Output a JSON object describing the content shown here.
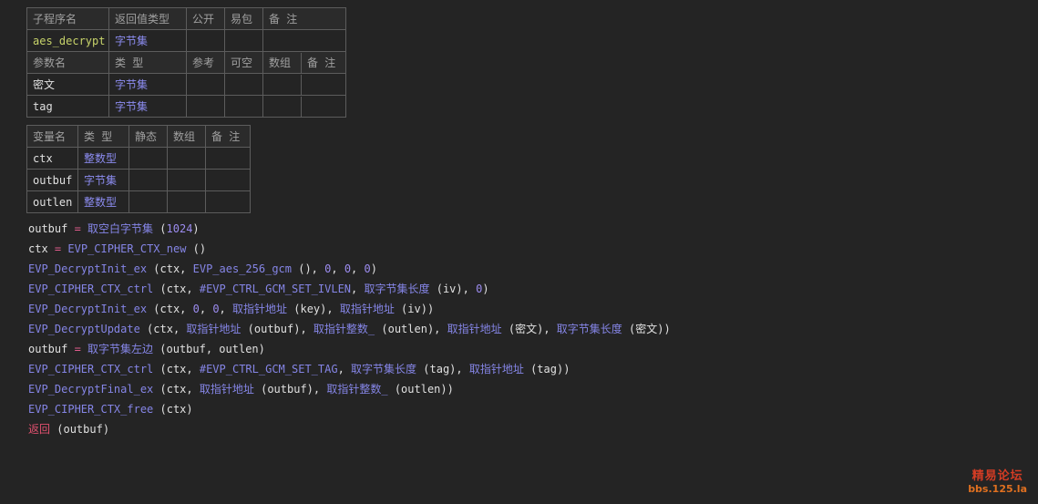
{
  "sub": {
    "headers": [
      "子程序名",
      "返回值类型",
      "公开",
      "易包",
      "备 注"
    ],
    "name": "aes_decrypt",
    "return_type": "字节集"
  },
  "params": {
    "headers": [
      "参数名",
      "类 型",
      "参考",
      "可空",
      "数组",
      "备 注"
    ],
    "rows": [
      {
        "name": "密文",
        "type": "字节集"
      },
      {
        "name": "tag",
        "type": "字节集"
      }
    ]
  },
  "vars": {
    "headers": [
      "变量名",
      "类 型",
      "静态",
      "数组",
      "备 注"
    ],
    "rows": [
      {
        "name": "ctx",
        "type": "整数型"
      },
      {
        "name": "outbuf",
        "type": "字节集"
      },
      {
        "name": "outlen",
        "type": "整数型"
      }
    ]
  },
  "code": [
    [
      [
        "plain",
        "outbuf "
      ],
      [
        "op",
        "="
      ],
      [
        "plain",
        " "
      ],
      [
        "cmd",
        "取空白字节集"
      ],
      [
        "plain",
        " ("
      ],
      [
        "num",
        "1024"
      ],
      [
        "plain",
        ")"
      ]
    ],
    [
      [
        "plain",
        "ctx "
      ],
      [
        "op",
        "="
      ],
      [
        "plain",
        " "
      ],
      [
        "fn",
        "EVP_CIPHER_CTX_new"
      ],
      [
        "plain",
        " ()"
      ]
    ],
    [
      [
        "fn",
        "EVP_DecryptInit_ex"
      ],
      [
        "plain",
        " (ctx, "
      ],
      [
        "fn",
        "EVP_aes_256_gcm"
      ],
      [
        "plain",
        " (), "
      ],
      [
        "num",
        "0"
      ],
      [
        "plain",
        ", "
      ],
      [
        "num",
        "0"
      ],
      [
        "plain",
        ", "
      ],
      [
        "num",
        "0"
      ],
      [
        "plain",
        ")"
      ]
    ],
    [
      [
        "fn",
        "EVP_CIPHER_CTX_ctrl"
      ],
      [
        "plain",
        " (ctx, "
      ],
      [
        "const",
        "#EVP_CTRL_GCM_SET_IVLEN"
      ],
      [
        "plain",
        ", "
      ],
      [
        "cmd",
        "取字节集长度"
      ],
      [
        "plain",
        " (iv), "
      ],
      [
        "num",
        "0"
      ],
      [
        "plain",
        ")"
      ]
    ],
    [
      [
        "fn",
        "EVP_DecryptInit_ex"
      ],
      [
        "plain",
        " (ctx, "
      ],
      [
        "num",
        "0"
      ],
      [
        "plain",
        ", "
      ],
      [
        "num",
        "0"
      ],
      [
        "plain",
        ", "
      ],
      [
        "cmd",
        "取指针地址"
      ],
      [
        "plain",
        " (key), "
      ],
      [
        "cmd",
        "取指针地址"
      ],
      [
        "plain",
        " (iv))"
      ]
    ],
    [
      [
        "fn",
        "EVP_DecryptUpdate"
      ],
      [
        "plain",
        " (ctx, "
      ],
      [
        "cmd",
        "取指针地址"
      ],
      [
        "plain",
        " (outbuf), "
      ],
      [
        "cmd",
        "取指针整数_"
      ],
      [
        "plain",
        " (outlen), "
      ],
      [
        "cmd",
        "取指针地址"
      ],
      [
        "plain",
        " (密文), "
      ],
      [
        "cmd",
        "取字节集长度"
      ],
      [
        "plain",
        " (密文))"
      ]
    ],
    [
      [
        "plain",
        "outbuf "
      ],
      [
        "op",
        "="
      ],
      [
        "plain",
        " "
      ],
      [
        "cmd",
        "取字节集左边"
      ],
      [
        "plain",
        " (outbuf, outlen)"
      ]
    ],
    [
      [
        "fn",
        "EVP_CIPHER_CTX_ctrl"
      ],
      [
        "plain",
        " (ctx, "
      ],
      [
        "const",
        "#EVP_CTRL_GCM_SET_TAG"
      ],
      [
        "plain",
        ", "
      ],
      [
        "cmd",
        "取字节集长度"
      ],
      [
        "plain",
        " (tag), "
      ],
      [
        "cmd",
        "取指针地址"
      ],
      [
        "plain",
        " (tag))"
      ]
    ],
    [
      [
        "fn",
        "EVP_DecryptFinal_ex"
      ],
      [
        "plain",
        " (ctx, "
      ],
      [
        "cmd",
        "取指针地址"
      ],
      [
        "plain",
        " (outbuf), "
      ],
      [
        "cmd",
        "取指针整数_"
      ],
      [
        "plain",
        " (outlen))"
      ]
    ],
    [
      [
        "fn",
        "EVP_CIPHER_CTX_free"
      ],
      [
        "plain",
        " (ctx)"
      ]
    ],
    [
      [
        "kw",
        "返回"
      ],
      [
        "plain",
        " (outbuf)"
      ]
    ]
  ],
  "watermark": {
    "line1": "精易论坛",
    "line2": "bbs.125.la"
  }
}
